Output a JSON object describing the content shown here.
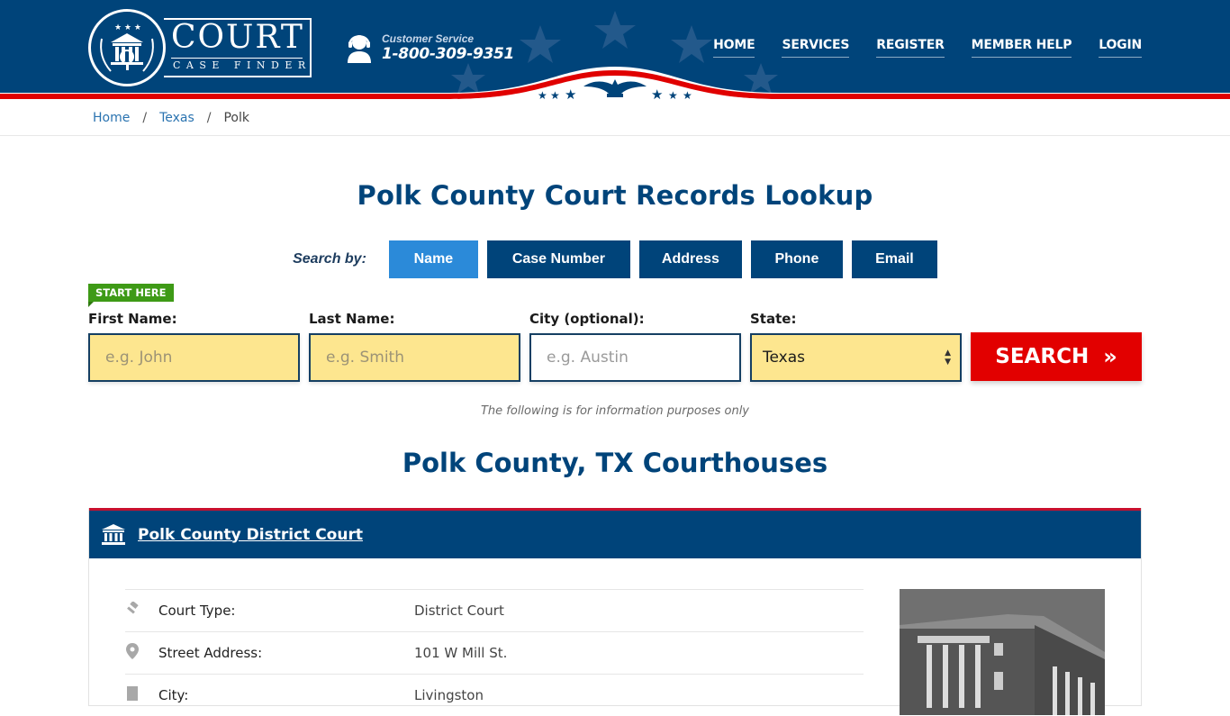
{
  "header": {
    "logo": {
      "title": "COURT",
      "subtitle": "CASE FINDER"
    },
    "customer_service": {
      "label": "Customer Service",
      "phone": "1-800-309-9351"
    },
    "nav": [
      {
        "label": "HOME"
      },
      {
        "label": "SERVICES"
      },
      {
        "label": "REGISTER"
      },
      {
        "label": "MEMBER HELP"
      },
      {
        "label": "LOGIN"
      }
    ]
  },
  "breadcrumb": [
    {
      "label": "Home"
    },
    {
      "label": "Texas"
    },
    {
      "label": "Polk"
    }
  ],
  "page_title": "Polk County Court Records Lookup",
  "search": {
    "search_by_label": "Search by:",
    "tabs": [
      {
        "label": "Name",
        "active": true
      },
      {
        "label": "Case Number",
        "active": false
      },
      {
        "label": "Address",
        "active": false
      },
      {
        "label": "Phone",
        "active": false
      },
      {
        "label": "Email",
        "active": false
      }
    ],
    "start_here": "START HERE",
    "fields": {
      "first_name": {
        "label": "First Name:",
        "placeholder": "e.g. John",
        "value": ""
      },
      "last_name": {
        "label": "Last Name:",
        "placeholder": "e.g. Smith",
        "value": ""
      },
      "city": {
        "label": "City (optional):",
        "placeholder": "e.g.  Austin",
        "value": ""
      },
      "state": {
        "label": "State:",
        "value": "Texas"
      }
    },
    "search_button": "SEARCH",
    "search_button_icon": "»"
  },
  "disclaimer": "The following is for information purposes only",
  "courthouses_title": "Polk County, TX Courthouses",
  "courthouse": {
    "name": "Polk County District Court",
    "details": [
      {
        "icon": "gavel-icon",
        "label": "Court Type:",
        "value": "District Court"
      },
      {
        "icon": "map-pin-icon",
        "label": "Street Address:",
        "value": "101 W Mill St."
      },
      {
        "icon": "building-icon",
        "label": "City:",
        "value": "Livingston"
      }
    ]
  },
  "colors": {
    "brand_blue": "#00447a",
    "active_tab": "#2b8ad9",
    "search_red": "#e20000",
    "start_green": "#3e9a16",
    "input_yellow": "#fde68f"
  }
}
